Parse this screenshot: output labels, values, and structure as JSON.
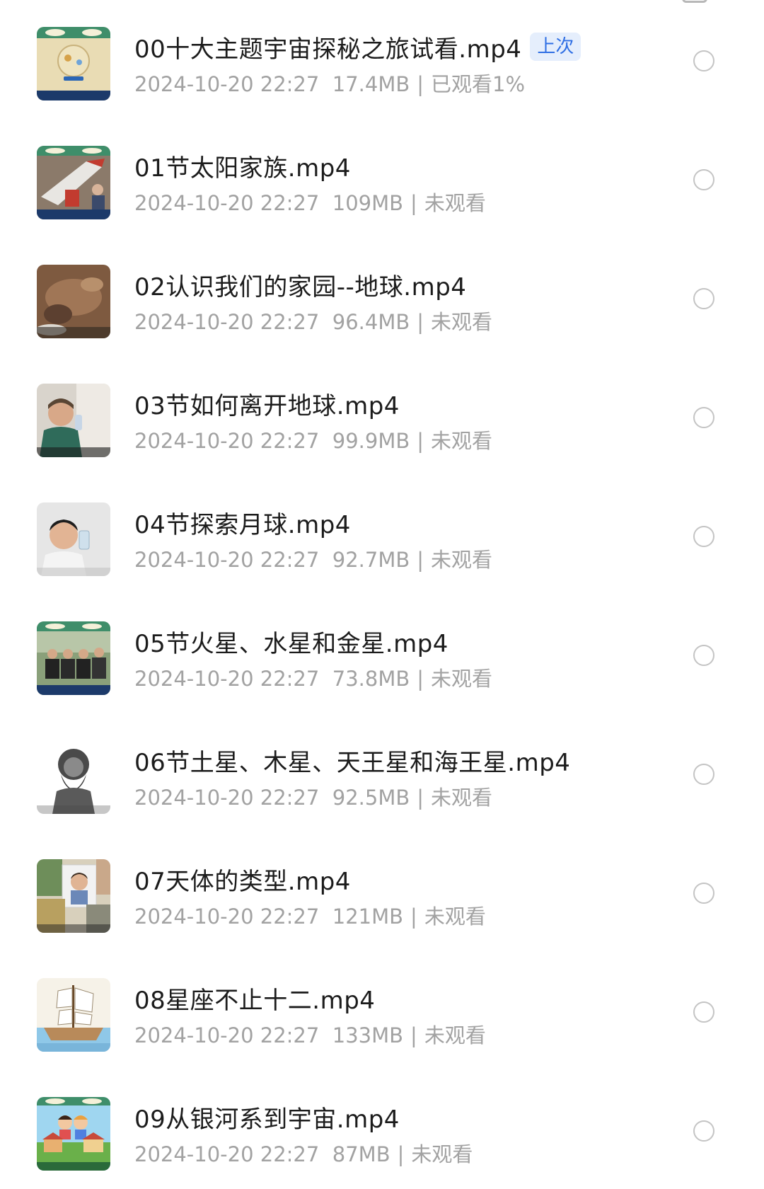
{
  "header": {},
  "items": [
    {
      "title": "00十大主题宇宙探秘之旅试看.mp4",
      "badge": "上次",
      "date": "2024-10-20 22:27",
      "size": "17.4MB",
      "status": "已观看1%",
      "thumb": "space-station-scene"
    },
    {
      "title": "01节太阳家族.mp4",
      "badge": "",
      "date": "2024-10-20 22:27",
      "size": "109MB",
      "status": "未观看",
      "thumb": "rocket-museum-scene"
    },
    {
      "title": "02认识我们的家园--地球.mp4",
      "badge": "",
      "date": "2024-10-20 22:27",
      "size": "96.4MB",
      "status": "未观看",
      "thumb": "earth-terrain-scene"
    },
    {
      "title": "03节如何离开地球.mp4",
      "badge": "",
      "date": "2024-10-20 22:27",
      "size": "99.9MB",
      "status": "未观看",
      "thumb": "astronaut-drinking-scene"
    },
    {
      "title": "04节探索月球.mp4",
      "badge": "",
      "date": "2024-10-20 22:27",
      "size": "92.7MB",
      "status": "未观看",
      "thumb": "boy-drinking-scene"
    },
    {
      "title": "05节火星、水星和金星.mp4",
      "badge": "",
      "date": "2024-10-20 22:27",
      "size": "73.8MB",
      "status": "未观看",
      "thumb": "people-on-bench-scene"
    },
    {
      "title": "06节土星、木星、天王星和海王星.mp4",
      "badge": "",
      "date": "2024-10-20 22:27",
      "size": "92.5MB",
      "status": "未观看",
      "thumb": "zeus-statue-scene"
    },
    {
      "title": "07天体的类型.mp4",
      "badge": "",
      "date": "2024-10-20 22:27",
      "size": "121MB",
      "status": "未观看",
      "thumb": "photo-collage-scene"
    },
    {
      "title": "08星座不止十二.mp4",
      "badge": "",
      "date": "2024-10-20 22:27",
      "size": "133MB",
      "status": "未观看",
      "thumb": "sailing-ship-scene"
    },
    {
      "title": "09从银河系到宇宙.mp4",
      "badge": "",
      "date": "2024-10-20 22:27",
      "size": "87MB",
      "status": "未观看",
      "thumb": "cartoon-kids-scene"
    }
  ]
}
